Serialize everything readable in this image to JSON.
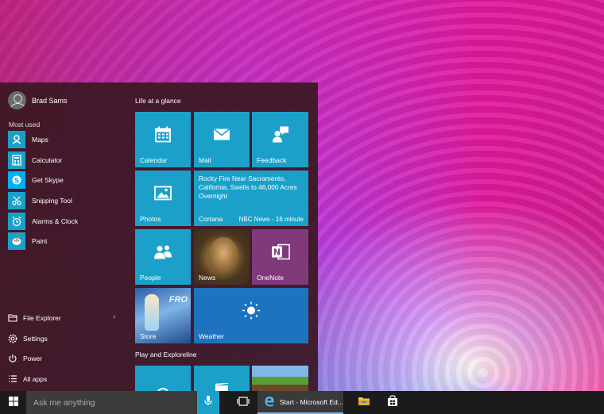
{
  "user": {
    "name": "Brad Sams"
  },
  "most_used": {
    "heading": "Most used",
    "apps": [
      {
        "label": "Maps",
        "icon": "maps-icon"
      },
      {
        "label": "Calculator",
        "icon": "calculator-icon"
      },
      {
        "label": "Get Skype",
        "icon": "skype-icon"
      },
      {
        "label": "Snipping Tool",
        "icon": "scissors-icon"
      },
      {
        "label": "Alarms & Clock",
        "icon": "alarm-clock-icon"
      },
      {
        "label": "Paint",
        "icon": "paint-palette-icon"
      }
    ]
  },
  "system": [
    {
      "label": "File Explorer",
      "icon": "folder-icon"
    },
    {
      "label": "Settings",
      "icon": "gear-icon"
    },
    {
      "label": "Power",
      "icon": "power-icon"
    },
    {
      "label": "All apps",
      "icon": "list-icon"
    }
  ],
  "groups": {
    "life": "Life at a glance",
    "play": "Play and Exploreline"
  },
  "tiles": {
    "calendar": "Calendar",
    "mail": "Mail",
    "feedback": "Feedback",
    "photos": "Photos",
    "cortana": "Cortana",
    "news_headline": "Rocky Fire Near Sacramento, California, Swells to 46,000 Acres Overnight",
    "news_source": "NBC News - 16 minute",
    "people": "People",
    "news": "News",
    "onenote": "OneNote",
    "store": "Store",
    "store_art_text": "FRO",
    "weather": "Weather"
  },
  "taskbar": {
    "search_placeholder": "Ask me anything",
    "edge_label": "Start - Microsoft Ed..."
  },
  "colors": {
    "accent": "#1ba1c9",
    "onenote": "#80397b",
    "weather": "#1e73be",
    "start_bg": "#3a1822",
    "taskbar": "#1b1b1b"
  }
}
